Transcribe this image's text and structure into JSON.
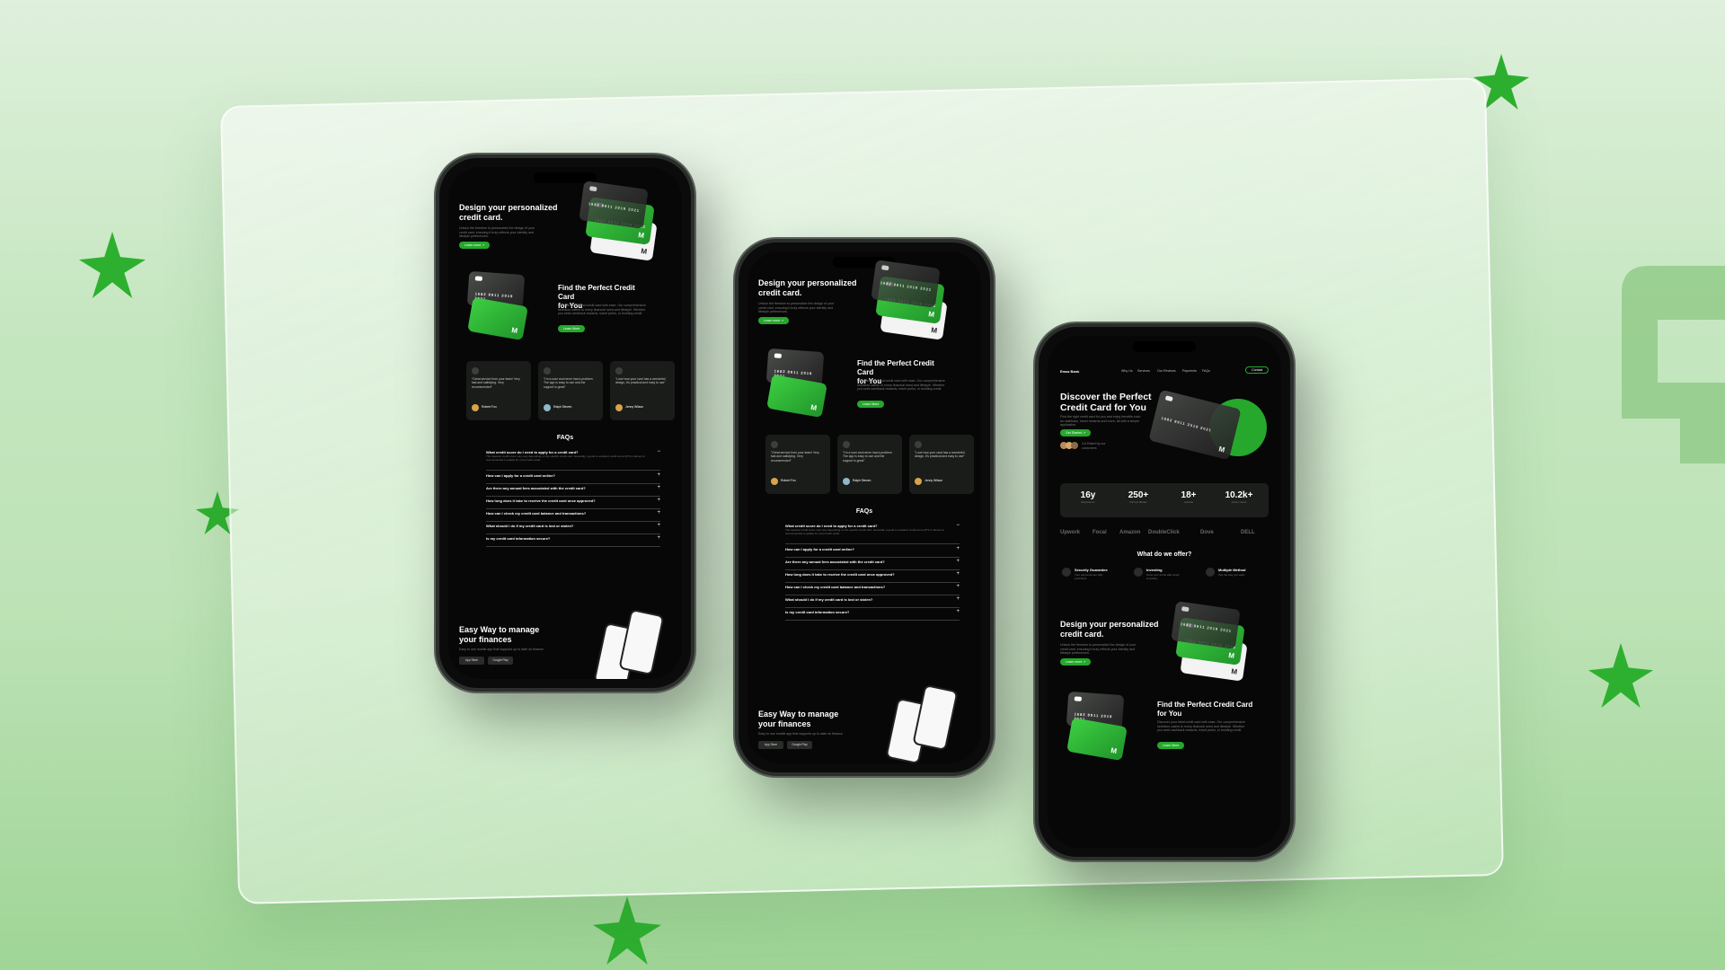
{
  "colors": {
    "accent": "#26a82d",
    "background": "#c4e6bf",
    "phone_bg": "#070707"
  },
  "icons": [
    "star-icon",
    "bookmark-logo-icon"
  ],
  "phone1": {
    "hero": {
      "title_line1": "Design your personalized",
      "title_line2": "credit card.",
      "body": "Unlock the freedom to personalize the design of your credit card, ensuring it truly reflects your identity and lifestyle preferences.",
      "cta": "Learn more  ↗"
    },
    "card": {
      "number": "1682  8911  2019  2021",
      "holder": "Credit Card No",
      "mark": "M"
    },
    "find": {
      "title_line1": "Find the Perfect Credit Card",
      "title_line2": "for You",
      "body": "Discover your ideal credit card with ease. Our comprehensive selection caters to every financial need and lifestyle. Whether you seek cashback rewards, travel perks, or building credit.",
      "cta": "Learn More"
    },
    "testimonials": [
      {
        "quote": "\"Great service from your team! Very fast and satisfying. Very recommended\"",
        "name": "Robert Fox"
      },
      {
        "quote": "\"I'm a user and never had a problem. The app is easy to use and the support is great\"",
        "name": "Ralph Steven"
      },
      {
        "quote": "\"Love how your card has a wonderful design, it's practical and easy to use\"",
        "name": "Jenny Wilson"
      }
    ],
    "faq": {
      "title": "FAQs",
      "items": [
        {
          "q": "What credit score do I need to apply for a credit card?",
          "a": "The required credit score may vary depending on the specific credit card. Generally, a good to excellent credit score (670 or above) is recommended to qualify for most credit cards.",
          "icon": "−"
        },
        {
          "q": "How can I apply for a credit card online?",
          "icon": "+"
        },
        {
          "q": "Are there any annual fees associated with the credit card?",
          "icon": "+"
        },
        {
          "q": "How long does it take to receive the credit card once approved?",
          "icon": "+"
        },
        {
          "q": "How can I check my credit card balance and transactions?",
          "icon": "+"
        },
        {
          "q": "What should I do if my credit card is lost or stolen?",
          "icon": "+"
        },
        {
          "q": "Is my credit card information secure?",
          "icon": "+"
        }
      ]
    },
    "app": {
      "title_line1": "Easy Way to manage",
      "title_line2": "your finances",
      "body": "Easy to use mobile app that supports up to date on finance.",
      "store1": "App Store",
      "store2": "Google Play"
    }
  },
  "phone3": {
    "nav": {
      "logo": "Emaz Bank",
      "links": [
        "Why Us",
        "Services",
        "Our Reviews",
        "Payments",
        "FAQs"
      ],
      "cta": "Contact"
    },
    "hero": {
      "title_line1": "Discover the Perfect",
      "title_line2": "Credit Card for You",
      "body": "Find the right credit card for you and enjoy benefits such as cashback, travel rewards and more, all with a simple application.",
      "cta": "Get Started ↗",
      "rating": "4.8 Rated by our customers"
    },
    "stats": [
      {
        "value": "16y",
        "label": "Experience"
      },
      {
        "value": "250+",
        "label": "Partner Banks"
      },
      {
        "value": "18+",
        "label": "Awards"
      },
      {
        "value": "10.2k+",
        "label": "Active Users"
      }
    ],
    "brands": [
      "Upwork",
      "Focal",
      "Amazon",
      "DoubleClick",
      "Dove",
      "DELL"
    ],
    "offer": {
      "title": "What do we offer?",
      "items": [
        {
          "label": "Security Guarantee",
          "desc": "Your payments are fully protected."
        },
        {
          "label": "Investing",
          "desc": "Grow your funds with smart investing."
        },
        {
          "label": "Multiple Method",
          "desc": "Pay the way you want."
        }
      ]
    }
  }
}
